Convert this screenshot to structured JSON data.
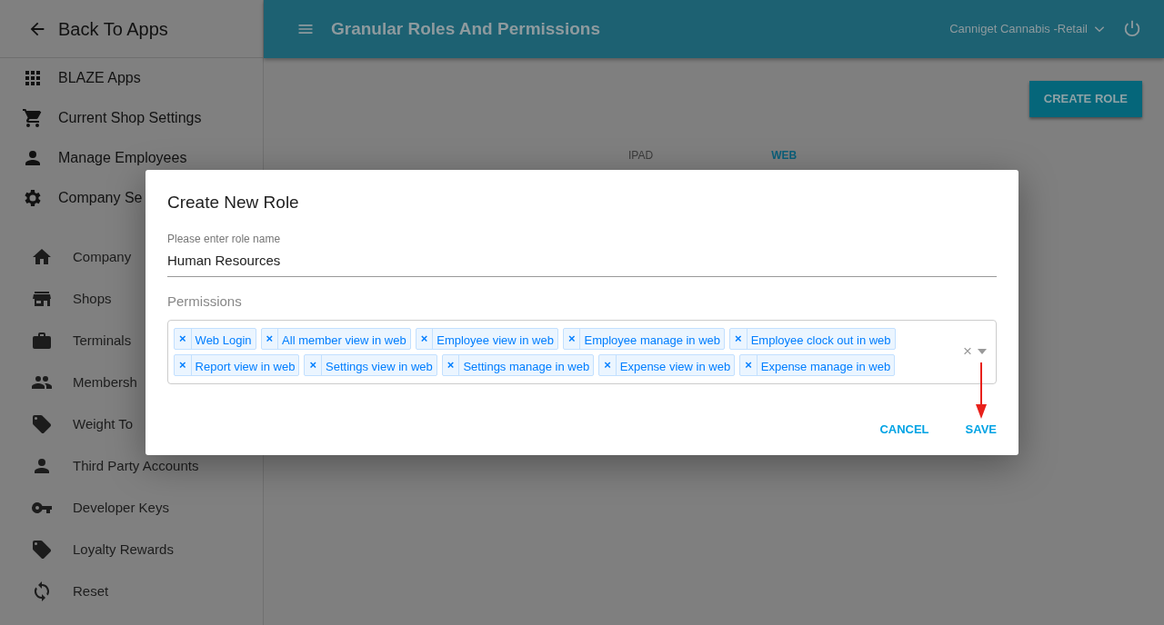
{
  "sidebar": {
    "back_label": "Back To Apps",
    "items": [
      {
        "label": "BLAZE Apps",
        "kind": "apps"
      },
      {
        "label": "Current Shop Settings",
        "kind": "cart"
      },
      {
        "label": "Manage Employees",
        "kind": "person"
      },
      {
        "label": "Company Se",
        "kind": "gear",
        "children": [
          {
            "label": "Company",
            "kind": "home"
          },
          {
            "label": "Shops",
            "kind": "store"
          },
          {
            "label": "Terminals",
            "kind": "briefcase"
          },
          {
            "label": "Membersh",
            "kind": "people"
          },
          {
            "label": "Weight To",
            "kind": "tag"
          },
          {
            "label": "Third Party Accounts",
            "kind": "person"
          },
          {
            "label": "Developer Keys",
            "kind": "key"
          },
          {
            "label": "Loyalty Rewards",
            "kind": "tag"
          },
          {
            "label": "Reset",
            "kind": "refresh"
          }
        ]
      }
    ]
  },
  "header": {
    "title": "Granular Roles And Permissions",
    "shop": "Canniget Cannabis -Retail"
  },
  "create_button": "CREATE ROLE",
  "tabs": [
    {
      "label": "IPAD",
      "selected": false
    },
    {
      "label": "WEB",
      "selected": true
    }
  ],
  "dialog": {
    "title": "Create New Role",
    "name_field": {
      "label": "Please enter role name",
      "value": "Human Resources"
    },
    "permissions_label": "Permissions",
    "permissions": [
      "Web Login",
      "All member view in web",
      "Employee view in web",
      "Employee manage in web",
      "Employee clock out in web",
      "Report view in web",
      "Settings view in web",
      "Settings manage in web",
      "Expense view in web",
      "Expense manage in web"
    ],
    "remove_mark": "×",
    "clear_mark": "×",
    "buttons": [
      "CANCEL",
      "SAVE"
    ]
  }
}
